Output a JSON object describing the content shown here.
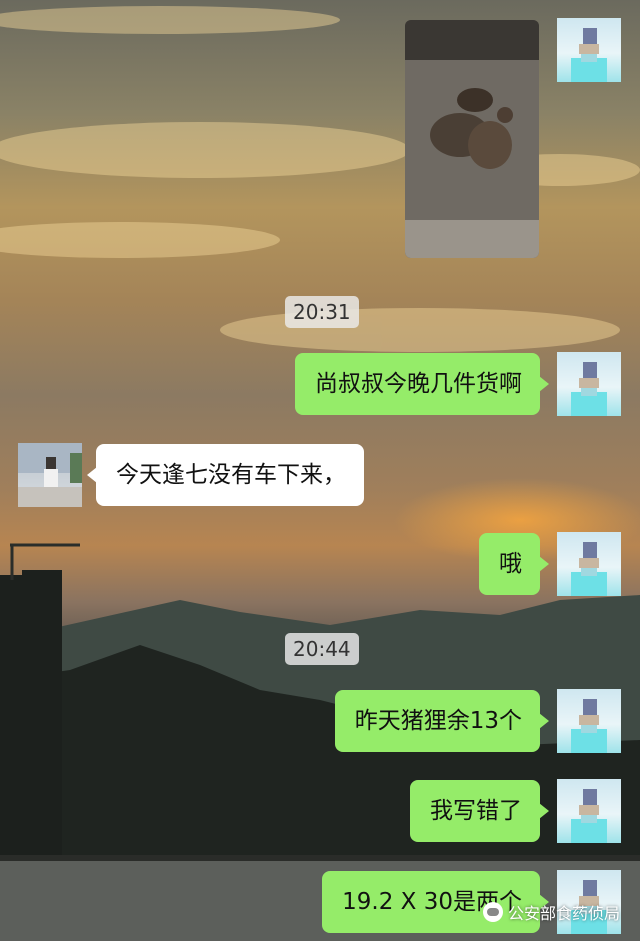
{
  "colors": {
    "outgoing_bubble": "#95ec69",
    "incoming_bubble": "#ffffff",
    "timestamp_bg": "#ebebeb"
  },
  "messages": {
    "photo": {
      "from": "me",
      "type": "image",
      "icon": "photo-thumbnail"
    },
    "time1": "20:31",
    "m1": {
      "from": "me",
      "text": "尚叔叔今晚几件货啊"
    },
    "m2": {
      "from": "contact",
      "text": "今天逢七没有车下来，"
    },
    "m3": {
      "from": "me",
      "text": "哦"
    },
    "time2": "20:44",
    "m4": {
      "from": "me",
      "text": "昨天猪狸余13个"
    },
    "m5": {
      "from": "me",
      "text": "我写错了"
    },
    "m6": {
      "from": "me",
      "text": "19.2 X 30是两个"
    }
  },
  "watermark": {
    "text": "公安部食药侦局",
    "icon": "wechat-public-icon"
  }
}
